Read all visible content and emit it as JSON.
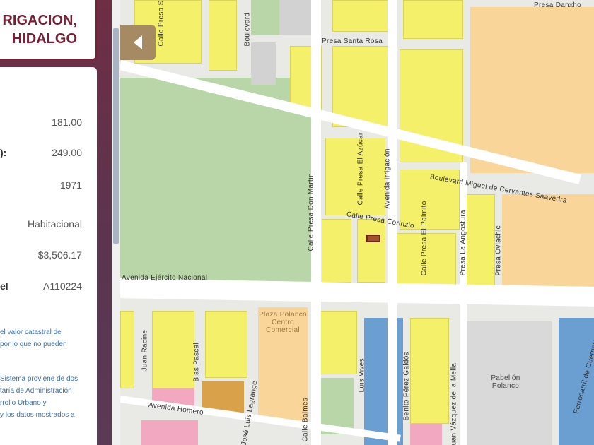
{
  "panel": {
    "title_lines": [
      "RIGACION,",
      "HIDALGO"
    ],
    "rows": [
      {
        "key": "",
        "value": "181.00"
      },
      {
        "key": "):",
        "value": "249.00"
      },
      {
        "key": "",
        "value": "1971"
      },
      {
        "key": "",
        "value": "Habitacional"
      },
      {
        "key": "",
        "value": "$3,506.17"
      },
      {
        "key": "el",
        "value": "A110224"
      }
    ],
    "note1": [
      "el valor catastral de",
      "por lo que no pueden"
    ],
    "note2": [
      "Sistema proviene de dos",
      "taría de Administración",
      "rrollo Urbano y",
      "y los datos mostrados a"
    ]
  },
  "toggle": {
    "icon": "chevron-left-icon"
  },
  "map": {
    "streets": [
      "Calle Presa Salinas",
      "Boulevard",
      "Presa Santa Rosa",
      "Presa Danxho",
      "Calle Presa Don Martín",
      "Calle Presa El Azúcar",
      "Avenida Irrigación",
      "Boulevard Miguel de Cervantes Saavedra",
      "Calle Presa Corinzio",
      "Calle Presa El Palmito",
      "Presa La Angostura",
      "Presa Oviachic",
      "Avenida Ejército Nacional",
      "Juan Racine",
      "Blas Pascal",
      "José Luis Lagrange",
      "Avenida Homero",
      "Calle Balmes",
      "Luis Vives",
      "Benito Pérez Galdós",
      "Juan Vázquez de la Mella",
      "Ferrocarril de Cuernavaca"
    ],
    "places": [
      "Plaza Polanco Centro Comercial",
      "Pabellón Polanco"
    ],
    "colors": {
      "habitacional": "#f4f06a",
      "park": "#b9d6a8",
      "commercial": "#f9d59a",
      "blue": "#6b9fd1",
      "pink": "#f2a8c1",
      "selected": "#a0522d",
      "title": "#7a1f33"
    }
  }
}
